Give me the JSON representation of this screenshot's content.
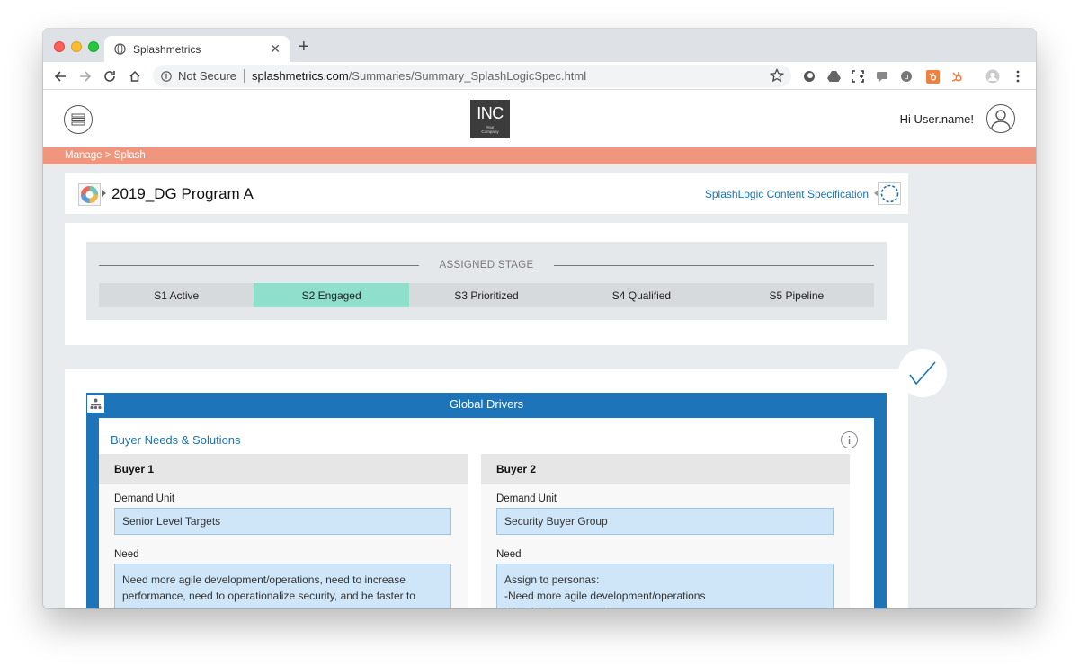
{
  "browser": {
    "tab_title": "Splashmetrics",
    "security_label": "Not Secure",
    "url_host": "splashmetrics.com",
    "url_path": "/Summaries/Summary_SplashLogicSpec.html"
  },
  "header": {
    "logo_text": "INC",
    "logo_sub_1": "Your",
    "logo_sub_2": "Company",
    "greeting": "Hi User.name!"
  },
  "breadcrumb": "Manage > Splash",
  "program": {
    "title": "2019_DG Program A",
    "spec_link": "SplashLogic Content Specification"
  },
  "stages": {
    "label": "ASSIGNED STAGE",
    "items": [
      "S1 Active",
      "S2 Engaged",
      "S3 Prioritized",
      "S4 Qualified",
      "S5 Pipeline"
    ],
    "active_index": 1
  },
  "drivers": {
    "title": "Global Drivers",
    "section_title": "Buyer Needs & Solutions",
    "buyers": [
      {
        "name": "Buyer 1",
        "demand_unit_label": "Demand Unit",
        "demand_unit": "Senior Level Targets",
        "need_label": "Need",
        "need": "Need more agile development/operations, need to increase performance, need to operationalize security, and be faster to market"
      },
      {
        "name": "Buyer 2",
        "demand_unit_label": "Demand Unit",
        "demand_unit": "Security Buyer Group",
        "need_label": "Need",
        "need": "Assign to personas:\n-Need more agile development/operations\n-Need to improve performance"
      }
    ]
  },
  "colors": {
    "breadcrumb_bg": "#f1967e",
    "active_stage": "#8fdfcd",
    "drivers_frame": "#1e74b8",
    "link": "#1a73b5"
  }
}
